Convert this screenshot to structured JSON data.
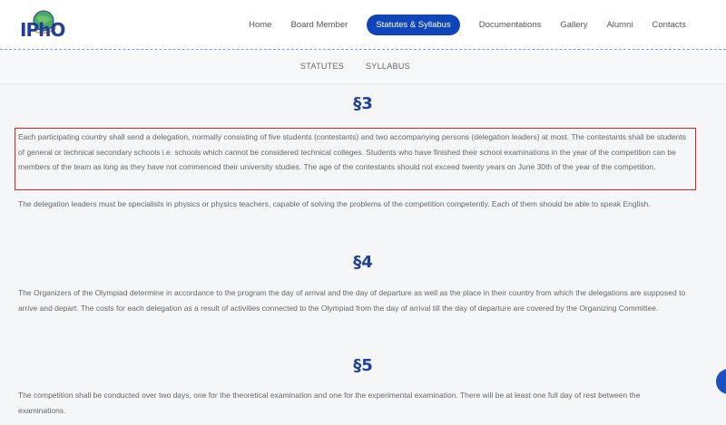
{
  "header": {
    "logo_text": "IPhO",
    "nav": [
      {
        "label": "Home"
      },
      {
        "label": "Board Member"
      },
      {
        "label": "Statutes & Syllabus"
      },
      {
        "label": "Documentations"
      },
      {
        "label": "Gallery"
      },
      {
        "label": "Alumni"
      },
      {
        "label": "Contacts"
      }
    ],
    "active_nav": "Statutes & Syllabus"
  },
  "subnav": {
    "items": [
      {
        "label": "STATUTES"
      },
      {
        "label": "SYLLABUS"
      }
    ]
  },
  "sections": [
    {
      "title": "§3",
      "paragraphs": [
        "Each participating country shall send a delegation, normally consisting of five students (contestants) and two accompanying persons (delegation leaders) at most. The contestants shall be students of general or technical secondary schools i.e. schools which cannot be considered technical colleges. Students who have finished their school examinations in the year of the competition can be members of the team as long as they have not commenced their university studies. The age of the contestants should not exceed twenty years on June 30th of the year of the competition.",
        "The delegation leaders must be specialists in physics or physics teachers, capable of solving the problems of the competition competently. Each of them should be able to speak English."
      ]
    },
    {
      "title": "§4",
      "paragraphs": [
        "The Organizers of the Olympiad determine in accordance to the program the day of arrival and the day of departure as well as the place in their country from which the delegations are supposed to arrive and depart. The costs for each delegation as a result of activities connected to the Olympiad from the day of arrival till the day of departure are covered by the Organizing Committee."
      ]
    },
    {
      "title": "§5",
      "paragraphs": [
        "The competition shall be conducted over two days, one for the theoretical examination and one for the experimental examination. There will be at least one full day of rest between the examinations."
      ]
    }
  ],
  "colors": {
    "accent": "#0f45b8",
    "section_title": "#1f3f9a",
    "highlight_border": "#e02020"
  }
}
